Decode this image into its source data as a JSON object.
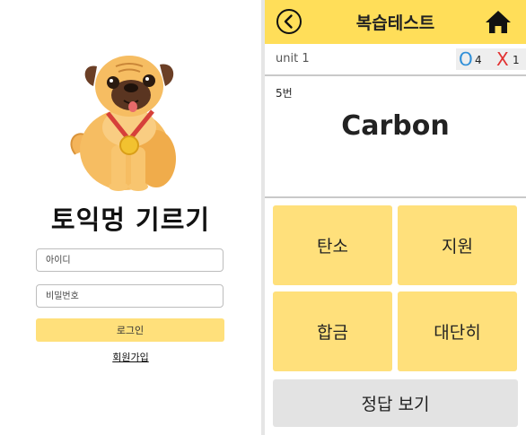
{
  "login": {
    "mascot_icon": "pug-with-medal-illustration",
    "title": "토익멍 기르기",
    "id_placeholder": "아이디",
    "password_placeholder": "비밀번호",
    "login_label": "로그인",
    "signup_label": "회원가입"
  },
  "quiz": {
    "header": {
      "back_icon": "circle-back-arrow-icon",
      "title": "복습테스트",
      "home_icon": "home-icon"
    },
    "unit_label": "unit 1",
    "score": {
      "correct_mark": "O",
      "correct_count": "4",
      "wrong_mark": "X",
      "wrong_count": "1"
    },
    "question_number": "5번",
    "word": "Carbon",
    "choices": [
      "탄소",
      "지원",
      "합금",
      "대단히"
    ],
    "show_answer_label": "정답 보기"
  },
  "colors": {
    "header_yellow": "#ffde59",
    "button_yellow": "#ffe07b",
    "correct_blue": "#2f8fd8",
    "wrong_red": "#e13131",
    "answer_gray": "#e3e3e3"
  }
}
